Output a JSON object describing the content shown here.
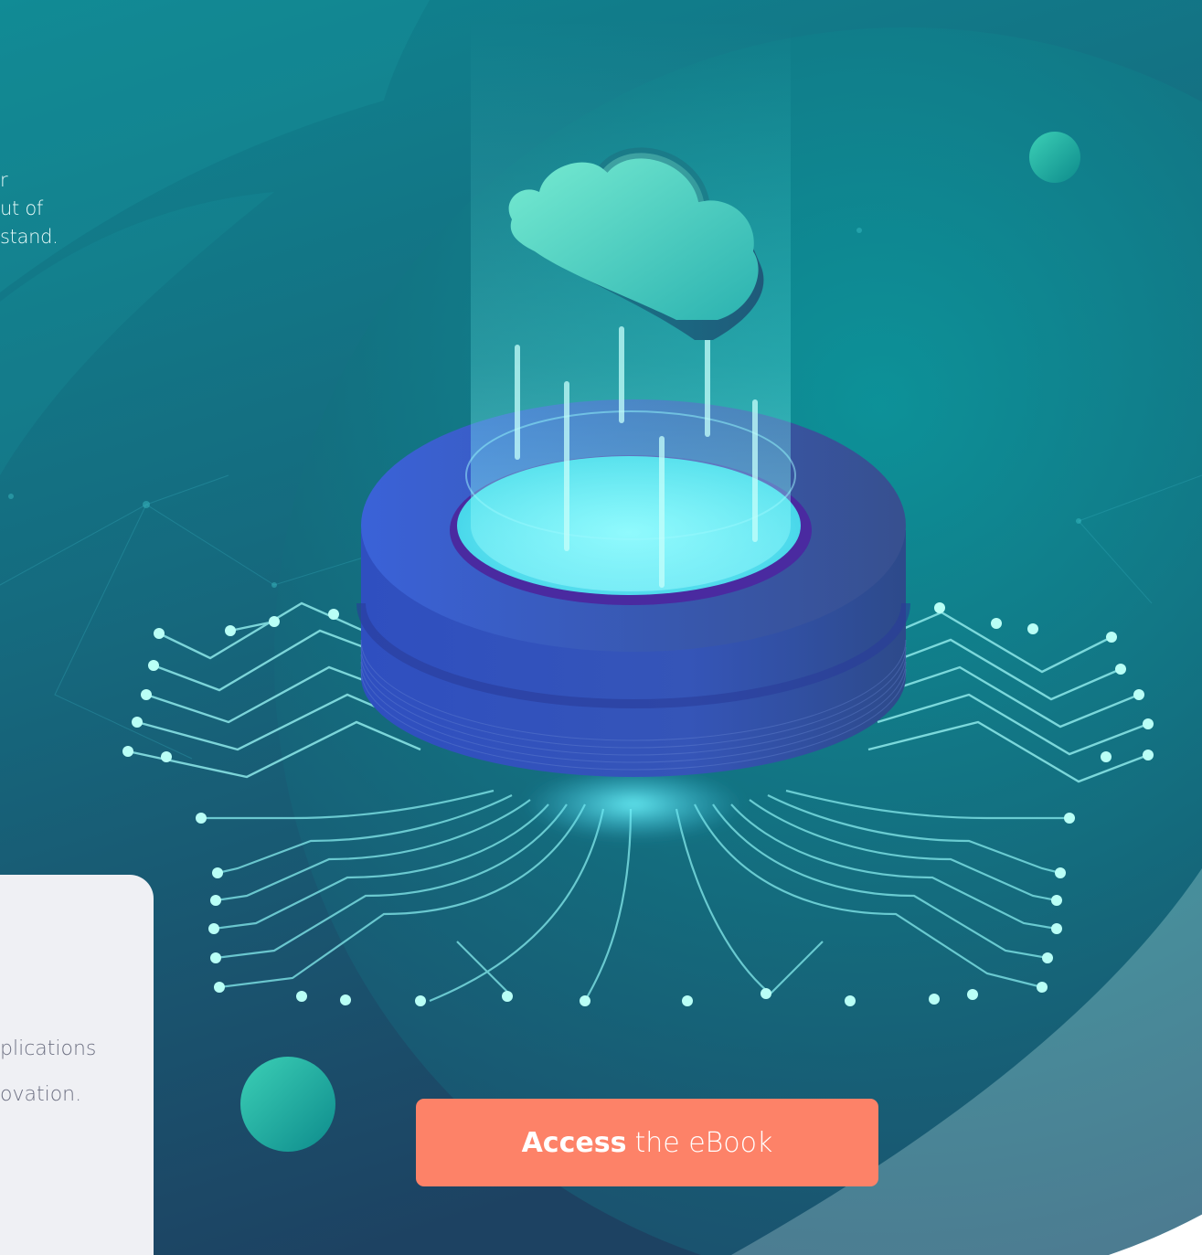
{
  "intro": {
    "lines": [
      "r",
      "ut of",
      "stand."
    ]
  },
  "card": {
    "lines": [
      "plications",
      "ovation."
    ]
  },
  "cta": {
    "bold_label": "Access",
    "label": "the eBook"
  },
  "colors": {
    "teal_dark": "#125a76",
    "teal_mid": "#0a8f98",
    "deep_navy": "#1e3a63",
    "accent_orange": "#fd8268",
    "card_bg": "#eff0f4",
    "glow_cyan": "#7ff4f4"
  },
  "icons": [
    "cloud-icon",
    "data-platform-icon",
    "circuit-traces"
  ]
}
